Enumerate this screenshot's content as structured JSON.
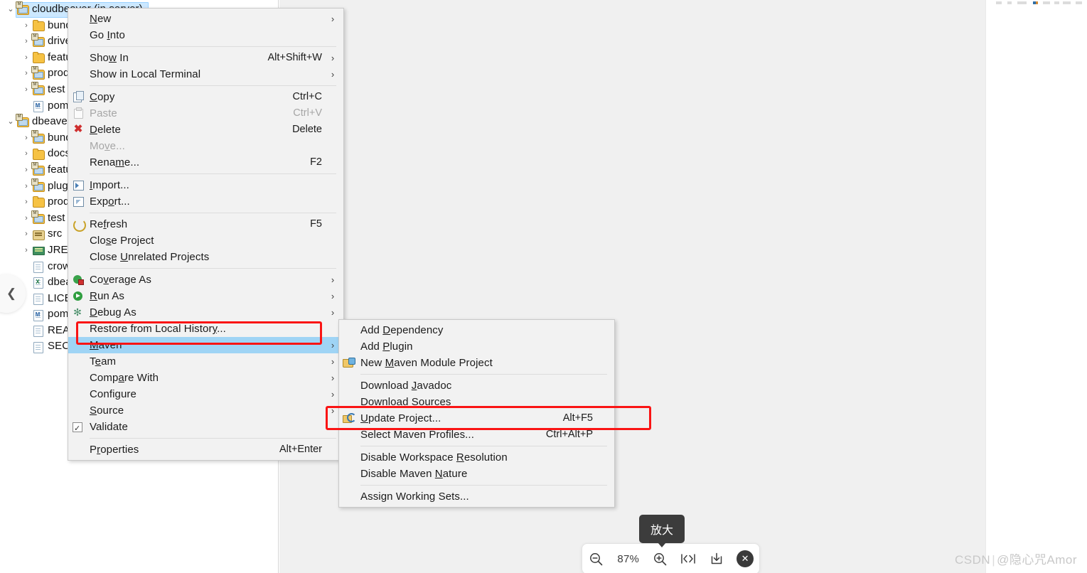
{
  "viewer": {
    "zoom_level": "87%",
    "tooltip": "放大",
    "zoom_out_icon": "magnifier-minus-icon",
    "zoom_in_icon": "magnifier-plus-icon",
    "fit_width_icon": "fit-width-icon",
    "download_icon": "download-icon",
    "close_icon": "close-icon",
    "prev_icon": "chevron-left-icon",
    "watermark_site": "CSDN",
    "watermark_user": "@隐心咒Amor"
  },
  "explorer": {
    "rows": [
      {
        "label": "cloudbeaver (in server)",
        "icon": "maven-project-folder-icon",
        "indent": 0,
        "twisty": "expanded",
        "selected": true
      },
      {
        "label": "bundles",
        "icon": "folder-icon",
        "indent": 1,
        "twisty": "collapsed",
        "selected": false
      },
      {
        "label": "drivers",
        "icon": "maven-project-folder-icon",
        "indent": 1,
        "twisty": "collapsed",
        "selected": false
      },
      {
        "label": "features",
        "icon": "folder-icon",
        "indent": 1,
        "twisty": "collapsed",
        "selected": false
      },
      {
        "label": "product",
        "icon": "maven-project-folder-icon",
        "indent": 1,
        "twisty": "collapsed",
        "selected": false
      },
      {
        "label": "test",
        "icon": "maven-project-folder-icon",
        "indent": 1,
        "twisty": "collapsed",
        "selected": false
      },
      {
        "label": "pom.xml",
        "icon": "maven-pom-file-icon",
        "indent": 1,
        "twisty": "none",
        "selected": false
      },
      {
        "label": "dbeaver",
        "icon": "maven-project-folder-icon",
        "indent": 0,
        "twisty": "expanded",
        "selected": false
      },
      {
        "label": "bundles",
        "icon": "maven-project-folder-icon",
        "indent": 1,
        "twisty": "collapsed",
        "selected": false
      },
      {
        "label": "docs",
        "icon": "folder-icon",
        "indent": 1,
        "twisty": "collapsed",
        "selected": false
      },
      {
        "label": "features",
        "icon": "maven-project-folder-icon",
        "indent": 1,
        "twisty": "collapsed",
        "selected": false
      },
      {
        "label": "plugins",
        "icon": "maven-project-folder-icon",
        "indent": 1,
        "twisty": "collapsed",
        "selected": false
      },
      {
        "label": "product",
        "icon": "folder-icon",
        "indent": 1,
        "twisty": "collapsed",
        "selected": false
      },
      {
        "label": "test",
        "icon": "maven-project-folder-icon",
        "indent": 1,
        "twisty": "collapsed",
        "selected": false
      },
      {
        "label": "src",
        "icon": "source-package-icon",
        "indent": 1,
        "twisty": "collapsed",
        "selected": false
      },
      {
        "label": "JRE System Library",
        "icon": "jre-library-icon",
        "indent": 1,
        "twisty": "collapsed",
        "selected": false
      },
      {
        "label": "crowdin.yml",
        "icon": "file-icon",
        "indent": 1,
        "twisty": "none",
        "selected": false
      },
      {
        "label": "dbeaver.xlsx",
        "icon": "excel-file-icon",
        "indent": 1,
        "twisty": "none",
        "selected": false
      },
      {
        "label": "LICENSE",
        "icon": "file-icon",
        "indent": 1,
        "twisty": "none",
        "selected": false
      },
      {
        "label": "pom.xml",
        "icon": "maven-pom-file-icon",
        "indent": 1,
        "twisty": "none",
        "selected": false
      },
      {
        "label": "README.md",
        "icon": "file-icon",
        "indent": 1,
        "twisty": "none",
        "selected": false
      },
      {
        "label": "SECURITY.md",
        "icon": "file-icon",
        "indent": 1,
        "twisty": "none",
        "selected": false
      }
    ]
  },
  "context_menu": {
    "items": [
      {
        "label": "New",
        "mnemonic": "N",
        "accel": "",
        "icon": "",
        "arrow": true,
        "sep_after": false,
        "disabled": false,
        "selected": false
      },
      {
        "label": "Go Into",
        "mnemonic": "I",
        "accel": "",
        "icon": "",
        "arrow": false,
        "sep_after": true,
        "disabled": false,
        "selected": false
      },
      {
        "label": "Show In",
        "mnemonic": "w",
        "accel": "Alt+Shift+W",
        "icon": "",
        "arrow": true,
        "sep_after": false,
        "disabled": false,
        "selected": false
      },
      {
        "label": "Show in Local Terminal",
        "mnemonic": "",
        "accel": "",
        "icon": "",
        "arrow": true,
        "sep_after": true,
        "disabled": false,
        "selected": false
      },
      {
        "label": "Copy",
        "mnemonic": "C",
        "accel": "Ctrl+C",
        "icon": "copy-icon",
        "arrow": false,
        "sep_after": false,
        "disabled": false,
        "selected": false
      },
      {
        "label": "Paste",
        "mnemonic": "",
        "accel": "Ctrl+V",
        "icon": "paste-icon",
        "arrow": false,
        "sep_after": false,
        "disabled": true,
        "selected": false
      },
      {
        "label": "Delete",
        "mnemonic": "D",
        "accel": "Delete",
        "icon": "delete-icon",
        "arrow": false,
        "sep_after": false,
        "disabled": false,
        "selected": false
      },
      {
        "label": "Move...",
        "mnemonic": "v",
        "accel": "",
        "icon": "",
        "arrow": false,
        "sep_after": false,
        "disabled": true,
        "selected": false
      },
      {
        "label": "Rename...",
        "mnemonic": "m",
        "accel": "F2",
        "icon": "",
        "arrow": false,
        "sep_after": true,
        "disabled": false,
        "selected": false
      },
      {
        "label": "Import...",
        "mnemonic": "I",
        "accel": "",
        "icon": "import-icon",
        "arrow": false,
        "sep_after": false,
        "disabled": false,
        "selected": false
      },
      {
        "label": "Export...",
        "mnemonic": "o",
        "accel": "",
        "icon": "export-icon",
        "arrow": false,
        "sep_after": true,
        "disabled": false,
        "selected": false
      },
      {
        "label": "Refresh",
        "mnemonic": "f",
        "accel": "F5",
        "icon": "refresh-icon",
        "arrow": false,
        "sep_after": false,
        "disabled": false,
        "selected": false
      },
      {
        "label": "Close Project",
        "mnemonic": "s",
        "accel": "",
        "icon": "",
        "arrow": false,
        "sep_after": false,
        "disabled": false,
        "selected": false
      },
      {
        "label": "Close Unrelated Projects",
        "mnemonic": "U",
        "accel": "",
        "icon": "",
        "arrow": false,
        "sep_after": true,
        "disabled": false,
        "selected": false
      },
      {
        "label": "Coverage As",
        "mnemonic": "v",
        "accel": "",
        "icon": "coverage-icon",
        "arrow": true,
        "sep_after": false,
        "disabled": false,
        "selected": false
      },
      {
        "label": "Run As",
        "mnemonic": "R",
        "accel": "",
        "icon": "run-icon",
        "arrow": true,
        "sep_after": false,
        "disabled": false,
        "selected": false
      },
      {
        "label": "Debug As",
        "mnemonic": "D",
        "accel": "",
        "icon": "debug-icon",
        "arrow": true,
        "sep_after": false,
        "disabled": false,
        "selected": false
      },
      {
        "label": "Restore from Local History...",
        "mnemonic": "y",
        "accel": "",
        "icon": "",
        "arrow": false,
        "sep_after": false,
        "disabled": false,
        "selected": false
      },
      {
        "label": "Maven",
        "mnemonic": "M",
        "accel": "",
        "icon": "",
        "arrow": true,
        "sep_after": false,
        "disabled": false,
        "selected": true
      },
      {
        "label": "Team",
        "mnemonic": "e",
        "accel": "",
        "icon": "",
        "arrow": true,
        "sep_after": false,
        "disabled": false,
        "selected": false
      },
      {
        "label": "Compare With",
        "mnemonic": "a",
        "accel": "",
        "icon": "",
        "arrow": true,
        "sep_after": false,
        "disabled": false,
        "selected": false
      },
      {
        "label": "Configure",
        "mnemonic": "g",
        "accel": "",
        "icon": "",
        "arrow": true,
        "sep_after": false,
        "disabled": false,
        "selected": false
      },
      {
        "label": "Source",
        "mnemonic": "S",
        "accel": "",
        "icon": "",
        "arrow": true,
        "sep_after": false,
        "disabled": false,
        "selected": false
      },
      {
        "label": "Validate",
        "mnemonic": "",
        "accel": "",
        "icon": "validate-check-icon",
        "arrow": false,
        "sep_after": true,
        "disabled": false,
        "selected": false
      },
      {
        "label": "Properties",
        "mnemonic": "r",
        "accel": "Alt+Enter",
        "icon": "",
        "arrow": false,
        "sep_after": false,
        "disabled": false,
        "selected": false
      }
    ]
  },
  "maven_submenu": {
    "items": [
      {
        "label": "Add Dependency",
        "mnemonic": "D",
        "accel": "",
        "icon": "",
        "sep_after": false,
        "highlighted": false
      },
      {
        "label": "Add Plugin",
        "mnemonic": "P",
        "accel": "",
        "icon": "",
        "sep_after": false,
        "highlighted": false
      },
      {
        "label": "New Maven Module Project",
        "mnemonic": "M",
        "accel": "",
        "icon": "new-maven-module-icon",
        "sep_after": true,
        "highlighted": false
      },
      {
        "label": "Download Javadoc",
        "mnemonic": "J",
        "accel": "",
        "icon": "",
        "sep_after": false,
        "highlighted": false
      },
      {
        "label": "Download Sources",
        "mnemonic": "S",
        "accel": "",
        "icon": "",
        "sep_after": false,
        "highlighted": false
      },
      {
        "label": "Update Project...",
        "mnemonic": "U",
        "accel": "Alt+F5",
        "icon": "update-project-icon",
        "sep_after": false,
        "highlighted": true
      },
      {
        "label": "Select Maven Profiles...",
        "mnemonic": "",
        "accel": "Ctrl+Alt+P",
        "icon": "",
        "sep_after": true,
        "highlighted": false
      },
      {
        "label": "Disable Workspace Resolution",
        "mnemonic": "R",
        "accel": "",
        "icon": "",
        "sep_after": false,
        "highlighted": false
      },
      {
        "label": "Disable Maven Nature",
        "mnemonic": "N",
        "accel": "",
        "icon": "",
        "sep_after": true,
        "highlighted": false
      },
      {
        "label": "Assign Working Sets...",
        "mnemonic": "",
        "accel": "",
        "icon": "",
        "sep_after": false,
        "highlighted": false
      }
    ]
  },
  "annotations": {
    "maven_box_color": "#fa1414",
    "update_box_color": "#fa1414"
  }
}
